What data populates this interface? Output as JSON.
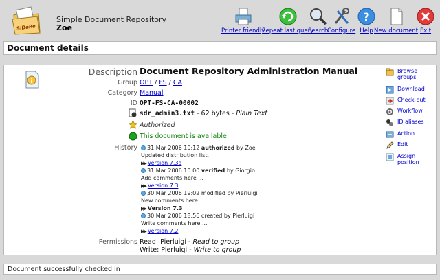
{
  "header": {
    "title": "Simple Document Repository",
    "user": "Zoe",
    "logo_text": "SiDoRe"
  },
  "toolbar": [
    {
      "label": "Printer friendly",
      "icon": "printer-icon"
    },
    {
      "label": "Repeat last query",
      "icon": "repeat-icon"
    },
    {
      "label": "Search",
      "icon": "search-icon"
    },
    {
      "label": "Configure",
      "icon": "configure-icon"
    },
    {
      "label": "Help",
      "icon": "help-icon"
    },
    {
      "label": "New document",
      "icon": "new-document-icon"
    },
    {
      "label": "Exit",
      "icon": "exit-icon"
    }
  ],
  "section_title": "Document details",
  "details": {
    "description_label": "Description",
    "description": "Document Repository Administration Manual",
    "group_label": "Group",
    "group_path": [
      "OPT",
      "FS",
      "CA"
    ],
    "group_sep": "/",
    "category_label": "Category",
    "category": "Manual",
    "id_label": "ID",
    "id": "OPT-FS-CA-00002",
    "file_name": "sdr_admin3.txt",
    "file_meta": " - 62 bytes - ",
    "file_type": "Plain Text",
    "state": "Authorized",
    "availability": "This document is available",
    "history_label": "History",
    "permissions_label": "Permissions",
    "perm_read": "Read: Pierluigi - ",
    "perm_read_note": "Read to group",
    "perm_write": "Write: Pierluigi - ",
    "perm_write_note": "Write to group"
  },
  "history": [
    {
      "date": "31 Mar 2006 10:12",
      "action": "authorized",
      "bold": true,
      "by": "by Zoe",
      "comment": "Updated distribution list.",
      "version": "Version 7.3a",
      "version_link": true
    },
    {
      "date": "31 Mar 2006 10:00",
      "action": "verified",
      "bold": true,
      "by": "by Giorgio",
      "comment": "Add comments here ...",
      "version": "Version 7.3",
      "version_link": true
    },
    {
      "date": "30 Mar 2006 19:02",
      "action": "modified",
      "bold": false,
      "by": "by Pierluigi",
      "comment": "New comments here ...",
      "version": "Version 7.3",
      "version_link": false
    },
    {
      "date": "30 Mar 2006 18:56",
      "action": "created",
      "bold": false,
      "by": "by Pierluigi",
      "comment": "Write comments here ...",
      "version": "Version 7.2",
      "version_link": true
    }
  ],
  "actions": [
    {
      "label": "Browse groups",
      "icon": "browse-groups-icon"
    },
    {
      "label": "Download",
      "icon": "download-icon"
    },
    {
      "label": "Check-out",
      "icon": "check-out-icon"
    },
    {
      "label": "Workflow",
      "icon": "workflow-icon"
    },
    {
      "label": "ID aliases",
      "icon": "id-aliases-icon"
    },
    {
      "label": "Action",
      "icon": "action-icon"
    },
    {
      "label": "Edit",
      "icon": "edit-icon"
    },
    {
      "label": "Assign position",
      "icon": "assign-position-icon"
    }
  ],
  "status": "Document successfully checked in"
}
